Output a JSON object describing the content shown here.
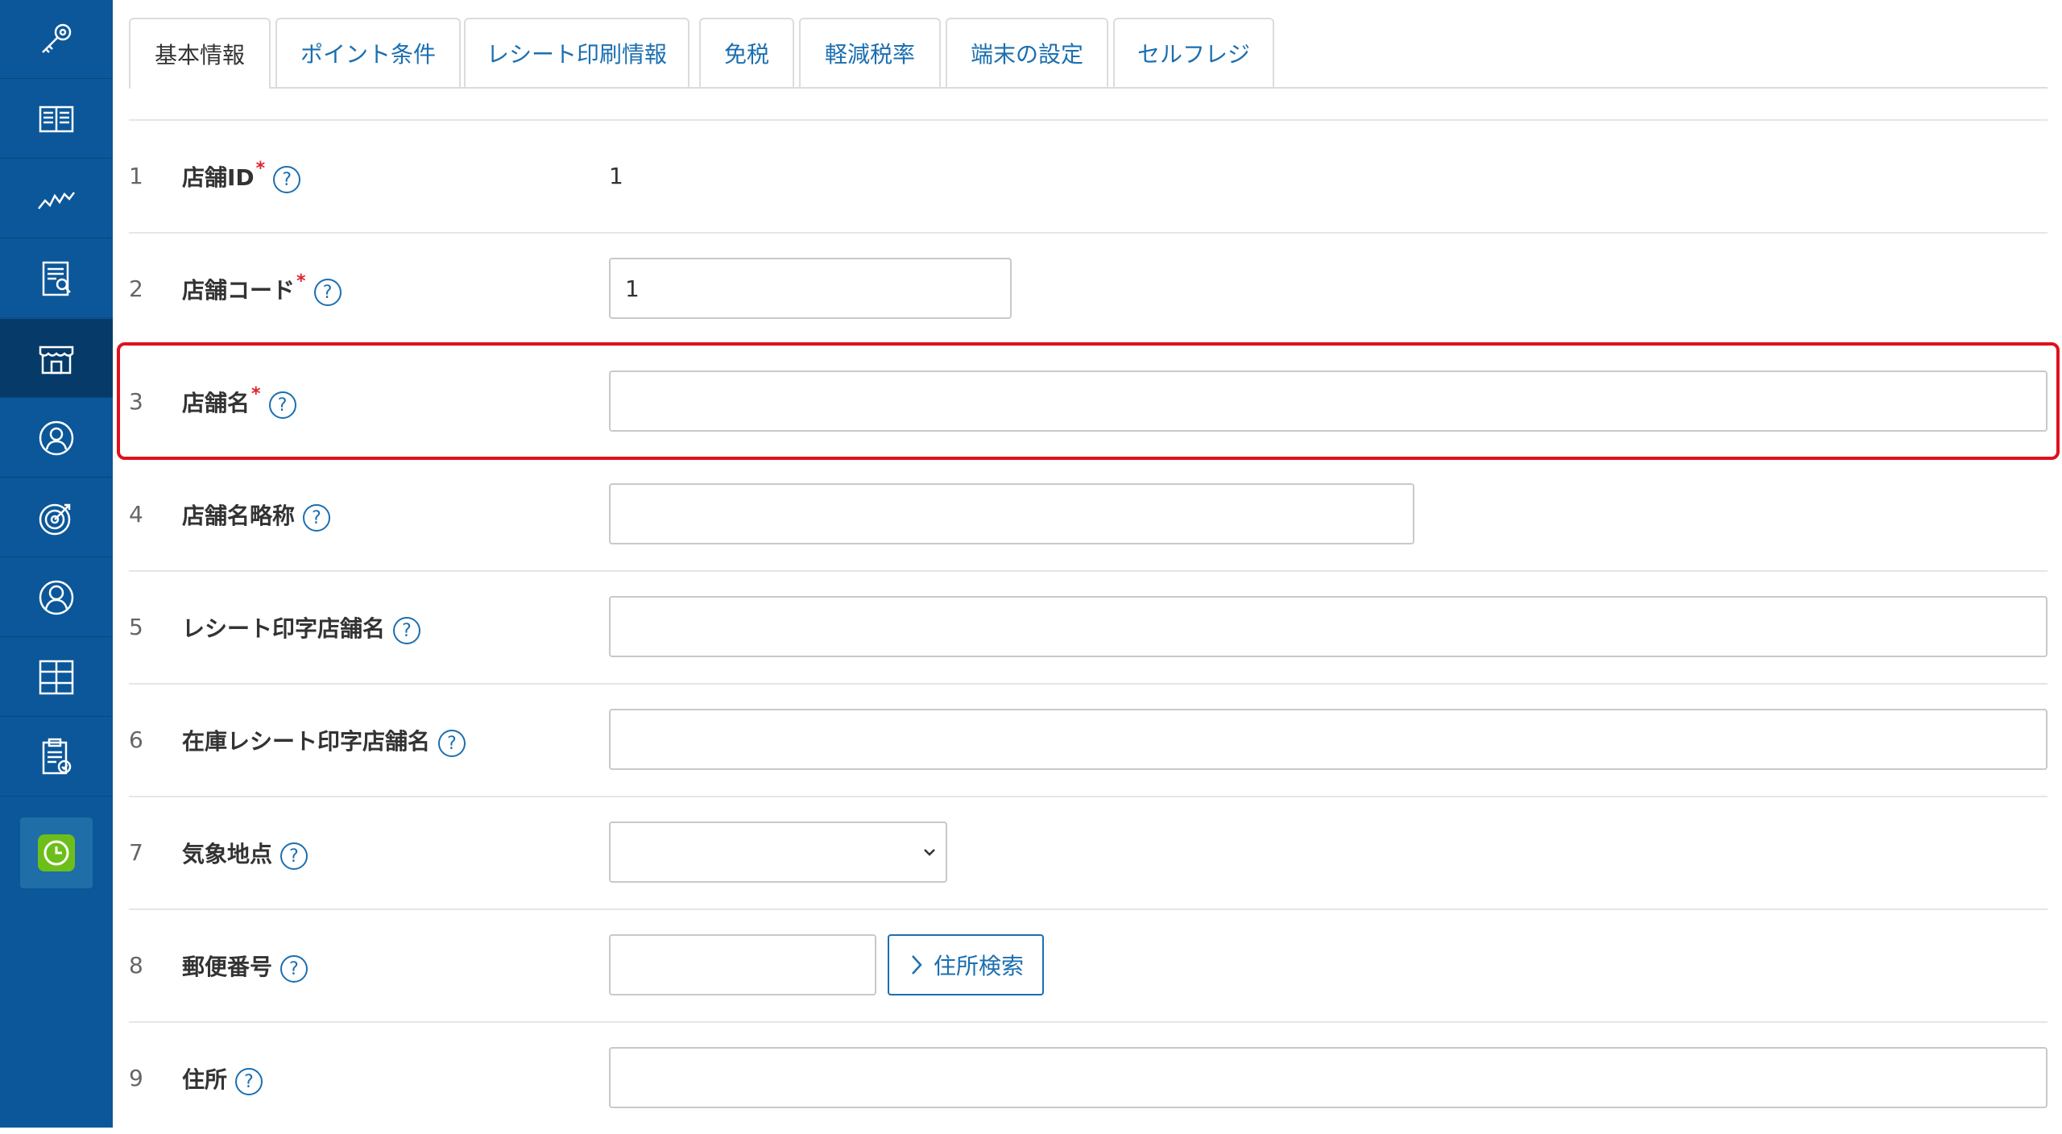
{
  "sidebar": {
    "items": [
      {
        "icon": "key-icon"
      },
      {
        "icon": "book-icon"
      },
      {
        "icon": "chart-line-icon"
      },
      {
        "icon": "report-search-icon"
      },
      {
        "icon": "store-icon",
        "active": true
      },
      {
        "icon": "customer-icon"
      },
      {
        "icon": "target-icon"
      },
      {
        "icon": "user-icon"
      },
      {
        "icon": "grid-icon"
      },
      {
        "icon": "clipboard-check-icon"
      },
      {
        "icon": "clock-icon"
      }
    ],
    "bg_color": "#0b5799",
    "active_color": "#063b69",
    "app_color": "#6cbf1a"
  },
  "tabs": [
    {
      "label": "基本情報",
      "active": true
    },
    {
      "label": "ポイント条件"
    },
    {
      "label": "レシート印刷情報"
    },
    {
      "label": "免税"
    },
    {
      "label": "軽減税率"
    },
    {
      "label": "端末の設定"
    },
    {
      "label": "セルフレジ"
    }
  ],
  "form": {
    "rows": [
      {
        "num": "1",
        "label": "店舗ID",
        "required": true,
        "value": "1"
      },
      {
        "num": "2",
        "label": "店舗コード",
        "required": true,
        "input_value": "1"
      },
      {
        "num": "3",
        "label": "店舗名",
        "required": true,
        "input_value": ""
      },
      {
        "num": "4",
        "label": "店舗名略称",
        "required": false,
        "input_value": ""
      },
      {
        "num": "5",
        "label": "レシート印字店舗名",
        "required": false,
        "input_value": ""
      },
      {
        "num": "6",
        "label": "在庫レシート印字店舗名",
        "required": false,
        "input_value": ""
      },
      {
        "num": "7",
        "label": "気象地点",
        "required": false,
        "select_value": ""
      },
      {
        "num": "8",
        "label": "郵便番号",
        "required": false,
        "input_value": "",
        "button_label": "住所検索"
      },
      {
        "num": "9",
        "label": "住所",
        "required": false,
        "input_value": ""
      }
    ],
    "required_mark": "*",
    "help_mark": "?"
  },
  "colors": {
    "link": "#1b6fb0",
    "required": "#e0242f",
    "highlight": "#e0101e"
  }
}
